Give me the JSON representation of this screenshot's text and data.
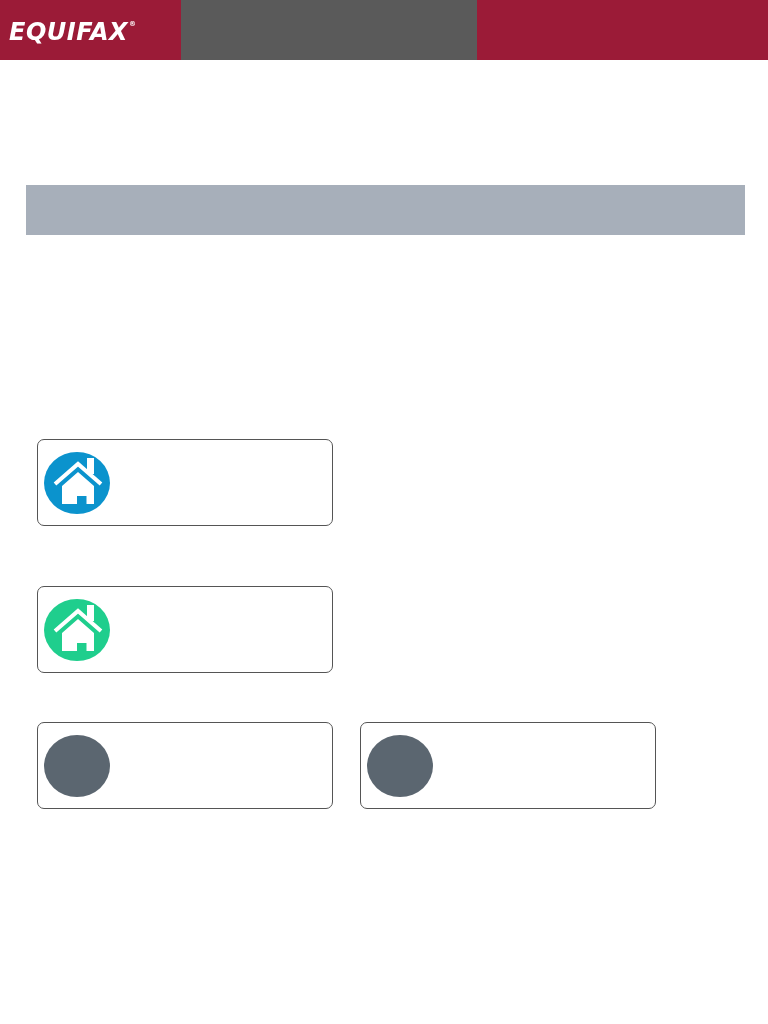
{
  "header": {
    "logo": "EQUIFAX$^{®}$"
  },
  "rows": [
    {
      "cards": [
        {
          "kind": "house",
          "color": "#0b93cd"
        }
      ]
    },
    {
      "cards": [
        {
          "kind": "house",
          "color": "#1fce8d"
        }
      ]
    },
    {
      "cards": [
        {
          "kind": "plain",
          "color": "#5b6670"
        },
        {
          "kind": "plain",
          "color": "#5b6670"
        }
      ]
    }
  ]
}
